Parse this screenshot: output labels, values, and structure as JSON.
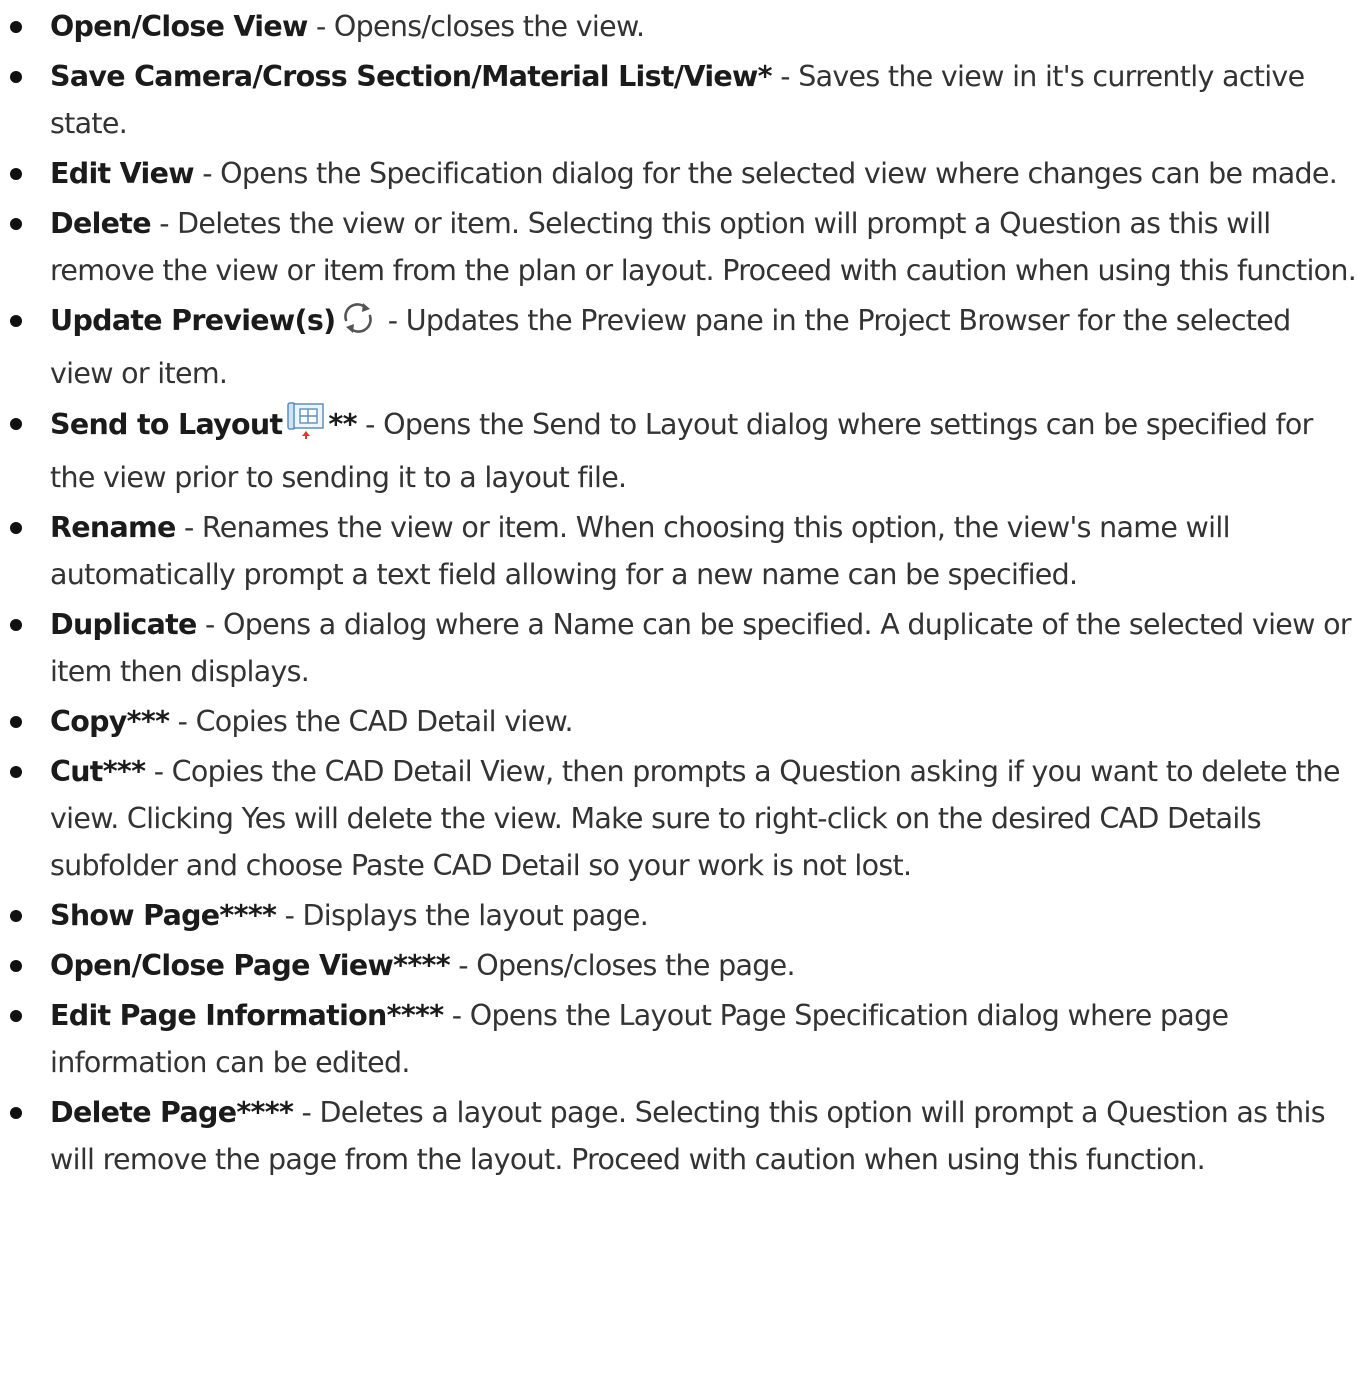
{
  "list": [
    {
      "term": "Open/Close View",
      "desc": " - Opens/closes the view."
    },
    {
      "term": "Save Camera/Cross Section/Material List/View*",
      "desc": " - Saves the view in it's currently active state."
    },
    {
      "term": "Edit View",
      "desc": " - Opens the Specification dialog for the selected view where changes can be made."
    },
    {
      "term": "Delete",
      "desc": " - Deletes the view or item. Selecting this option will prompt a Question as this will remove the view or item from the plan or layout. Proceed with caution when using this function."
    },
    {
      "term": "Update Preview(s)",
      "icon": "refresh-icon",
      "desc": " - Updates the Preview pane in the Project Browser for the selected view or item."
    },
    {
      "term": "Send to Layout",
      "icon": "send-to-layout-icon",
      "term_suffix": "**",
      "desc": " - Opens the Send to Layout dialog where settings can be specified for the view prior to sending it to a layout file."
    },
    {
      "term": "Rename",
      "desc": " - Renames the view or item. When choosing this option, the view's name will automatically prompt a text field allowing for a new name can be specified."
    },
    {
      "term": "Duplicate",
      "desc": " - Opens a dialog where a Name can be specified. A duplicate of the selected view or item then displays."
    },
    {
      "term": "Copy***",
      "desc": " - Copies the CAD Detail view."
    },
    {
      "term": "Cut***",
      "desc": " - Copies the CAD Detail View, then prompts a Question asking if you want to delete the view. Clicking Yes will delete the view. Make sure to right-click on the desired CAD Details subfolder and choose Paste CAD Detail so your work is not lost."
    },
    {
      "term": "Show Page****",
      "desc": " - Displays the layout page."
    },
    {
      "term": "Open/Close Page View****",
      "desc": " - Opens/closes the page."
    },
    {
      "term": "Edit Page Information****",
      "desc": " - Opens the Layout Page Specification dialog where page information can be edited."
    },
    {
      "term": "Delete Page****",
      "desc": " - Deletes a layout page. Selecting this option will prompt a Question as this will remove the page from the layout. Proceed with caution when using this function."
    }
  ]
}
